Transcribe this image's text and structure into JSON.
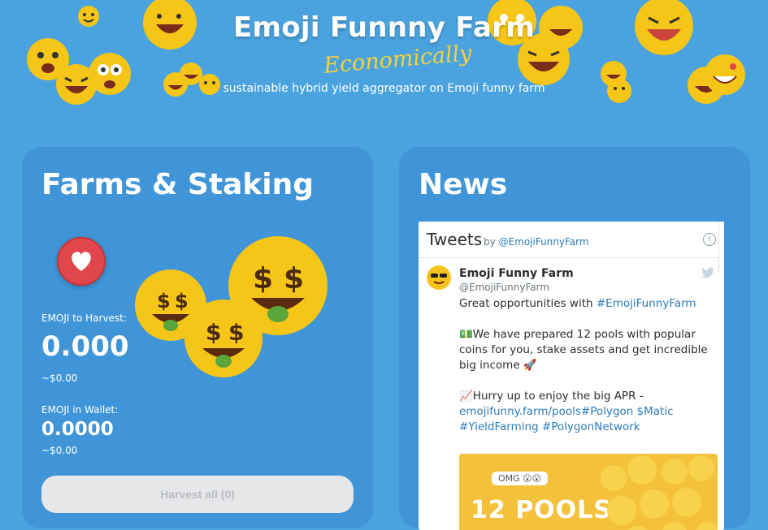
{
  "hero": {
    "title": "Emoji Funnny Farm",
    "script": "Economically",
    "subtitle": "sustainable hybrid yield aggregator on Emoji funny farm"
  },
  "farms": {
    "title": "Farms & Staking",
    "harvest_label": "EMOJI to Harvest:",
    "harvest_value": "0.000",
    "harvest_usd": "~$0.00",
    "wallet_label": "EMOJI in Wallet:",
    "wallet_value": "0.0000",
    "wallet_usd": "~$0.00",
    "harvest_button": "Harvest all (0)"
  },
  "news": {
    "title": "News",
    "tweets_title": "Tweets",
    "tweets_by": "by",
    "tweets_by_handle": "@EmojiFunnyFarm",
    "tweet": {
      "name": "Emoji Funny Farm",
      "handle": "@EmojiFunnyFarm",
      "line1": "Great opportunities with ",
      "line1_link": "#EmojiFunnyFarm",
      "line2": "💵We have prepared 12 pools with popular coins for you, stake assets and get incredible big income 🚀",
      "line3": "📈Hurry up to enjoy the big APR -",
      "line3_link": "emojifunny.farm/pools#Polygon $Matic #YieldFarming #PolygonNetwork",
      "image_badge": "OMG 😮😮",
      "image_text": "12 POOLS"
    }
  },
  "colors": {
    "background": "#4aa3df",
    "card": "#3f95d7",
    "accent_yellow": "#f6d23b",
    "heart_red": "#e0464c",
    "link": "#2b7bb9"
  }
}
